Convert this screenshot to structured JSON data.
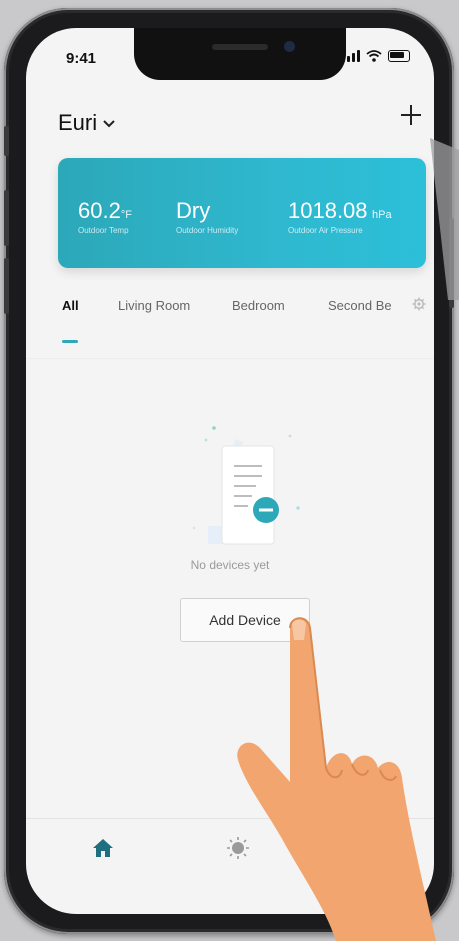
{
  "status_bar": {
    "time": "9:41"
  },
  "header": {
    "home_name": "Euri"
  },
  "weather": {
    "temp_value": "60.2",
    "temp_unit": "°F",
    "temp_label": "Outdoor Temp",
    "humidity_value": "Dry",
    "humidity_label": "Outdoor Humidity",
    "pressure_value": "1018.08",
    "pressure_unit": "hPa",
    "pressure_label": "Outdoor Air Pressure"
  },
  "tabs": [
    "All",
    "Living Room",
    "Bedroom",
    "Second Be"
  ],
  "empty_state": {
    "message": "No devices yet",
    "button_label": "Add Device"
  },
  "colors": {
    "accent": "#2ca8b9",
    "card_end": "#2bc0d8"
  },
  "icons": {
    "add": "plus-icon",
    "dropdown": "chevron-down-icon",
    "settings": "gear-icon",
    "home": "home-icon",
    "scenes": "sun-icon"
  }
}
